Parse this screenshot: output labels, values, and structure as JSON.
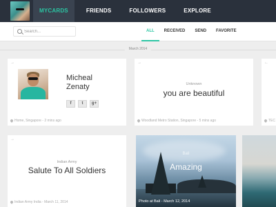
{
  "nav": {
    "items": [
      {
        "label": "MYCARDS",
        "active": true
      },
      {
        "label": "FRIENDS",
        "active": false
      },
      {
        "label": "FOLLOWERS",
        "active": false
      },
      {
        "label": "EXPLORE",
        "active": false
      }
    ]
  },
  "search": {
    "placeholder": "Search..."
  },
  "filters": [
    "ALL",
    "RECEIVED",
    "SEND",
    "FAVORITE"
  ],
  "date_divider": "March 2014",
  "profile_card": {
    "name_first": "Micheal",
    "name_last": "Zenaty",
    "socials": [
      "f",
      "t",
      "g+"
    ],
    "footer": "Home, Singapore - 2 mins ago"
  },
  "quote_card": {
    "kicker": "Unknown",
    "text": "you are beautiful",
    "footer": "Woodland Metro Station, Singapore - 5 mins ago"
  },
  "army_card": {
    "kicker": "Indian Army",
    "text": "Salute To All Soldiers",
    "footer": "Indian Army India - March 11, 2014"
  },
  "photo_card": {
    "kicker": "Bali",
    "title": "Amazing",
    "caption": "Photo at Bali - March 12, 2014"
  },
  "edge_card": {
    "footer": "TEC"
  },
  "colors": {
    "accent": "#2bc5a3",
    "nav_bg": "#2a313c",
    "page_bg": "#eeeeee"
  },
  "icons": {
    "share": "arrow-icon",
    "location": "pin-icon",
    "search": "search-icon"
  }
}
